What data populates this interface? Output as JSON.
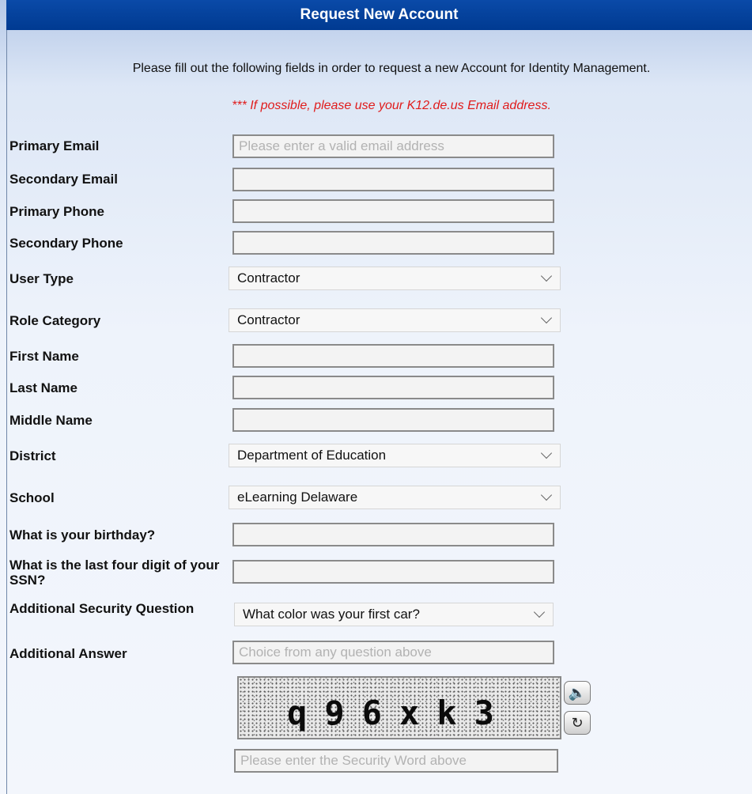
{
  "title": "Request New Account",
  "intro": {
    "text": "Please fill out the following fields in order to request a new Account for Identity Management.",
    "note": "*** If possible, please use your K12.de.us Email address."
  },
  "fields": {
    "primary_email": {
      "label": "Primary Email",
      "value": "",
      "placeholder": "Please enter a valid email address"
    },
    "secondary_email": {
      "label": "Secondary Email",
      "value": "",
      "placeholder": ""
    },
    "primary_phone": {
      "label": "Primary Phone",
      "value": "",
      "placeholder": ""
    },
    "secondary_phone": {
      "label": "Secondary Phone",
      "value": "",
      "placeholder": ""
    },
    "user_type": {
      "label": "User Type",
      "selected": "Contractor"
    },
    "role_category": {
      "label": "Role Category",
      "selected": "Contractor"
    },
    "first_name": {
      "label": "First Name",
      "value": "",
      "placeholder": ""
    },
    "last_name": {
      "label": "Last Name",
      "value": "",
      "placeholder": ""
    },
    "middle_name": {
      "label": "Middle Name",
      "value": "",
      "placeholder": ""
    },
    "district": {
      "label": "District",
      "selected": "Department of Education"
    },
    "school": {
      "label": "School",
      "selected": "eLearning Delaware"
    },
    "birthday": {
      "label": "What is your birthday?",
      "value": "",
      "placeholder": ""
    },
    "ssn_last4": {
      "label": "What is the last four digit of your SSN?",
      "value": "",
      "placeholder": ""
    },
    "security_question": {
      "label": "Additional Security Question",
      "selected": "What color was your first car?"
    },
    "additional_answer": {
      "label": "Additional Answer",
      "value": "",
      "placeholder": "Choice from any question above"
    }
  },
  "captcha": {
    "text": "q96xk3",
    "input_placeholder": "Please enter the Security Word above",
    "audio_icon": "speaker-icon",
    "refresh_icon": "refresh-icon"
  }
}
